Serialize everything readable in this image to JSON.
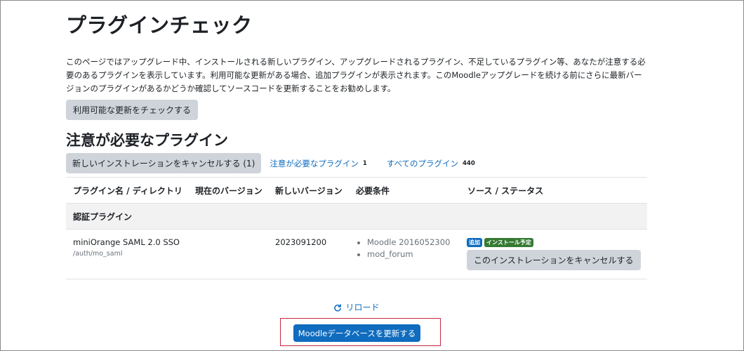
{
  "page": {
    "title": "プラグインチェック",
    "intro": "このページではアップグレード中、インストールされる新しいプラグイン、アップグレードされるプラグイン、不足しているプラグイン等、あなたが注意する必要のあるプラグインを表示しています。利用可能な更新がある場合、追加プラグインが表示されます。このMoodleアップグレードを続ける前にさらに最新バージョンのプラグインがあるかどうか確認してソースコードを更新することをお勧めします。",
    "check_updates_label": "利用可能な更新をチェックする"
  },
  "attention": {
    "heading": "注意が必要なプラグイン",
    "filters": {
      "cancel_label": "新しいインストレーションをキャンセルする (1)",
      "attention_label": "注意が必要なプラグイン",
      "attention_count": "1",
      "all_label": "すべてのプラグイン",
      "all_count": "440"
    }
  },
  "table": {
    "headers": [
      "プラグイン名 / ディレクトリ",
      "現在のバージョン",
      "新しいバージョン",
      "必要条件",
      "ソース / ステータス"
    ],
    "section": "認証プラグイン",
    "rows": [
      {
        "name": "miniOrange SAML 2.0 SSO",
        "path": "/auth/mo_saml",
        "current_version": "",
        "new_version": "2023091200",
        "requirements": [
          "Moodle 2016052300",
          "mod_forum"
        ],
        "badges": [
          "追加",
          "インストール予定"
        ],
        "action_label": "このインストレーションをキャンセルする"
      }
    ]
  },
  "footer": {
    "reload_label": "リロード",
    "upgrade_label": "Moodleデータベースを更新する"
  },
  "colors": {
    "primary": "#0f6cbf",
    "success": "#357a32",
    "highlight_border": "#c6263b"
  }
}
